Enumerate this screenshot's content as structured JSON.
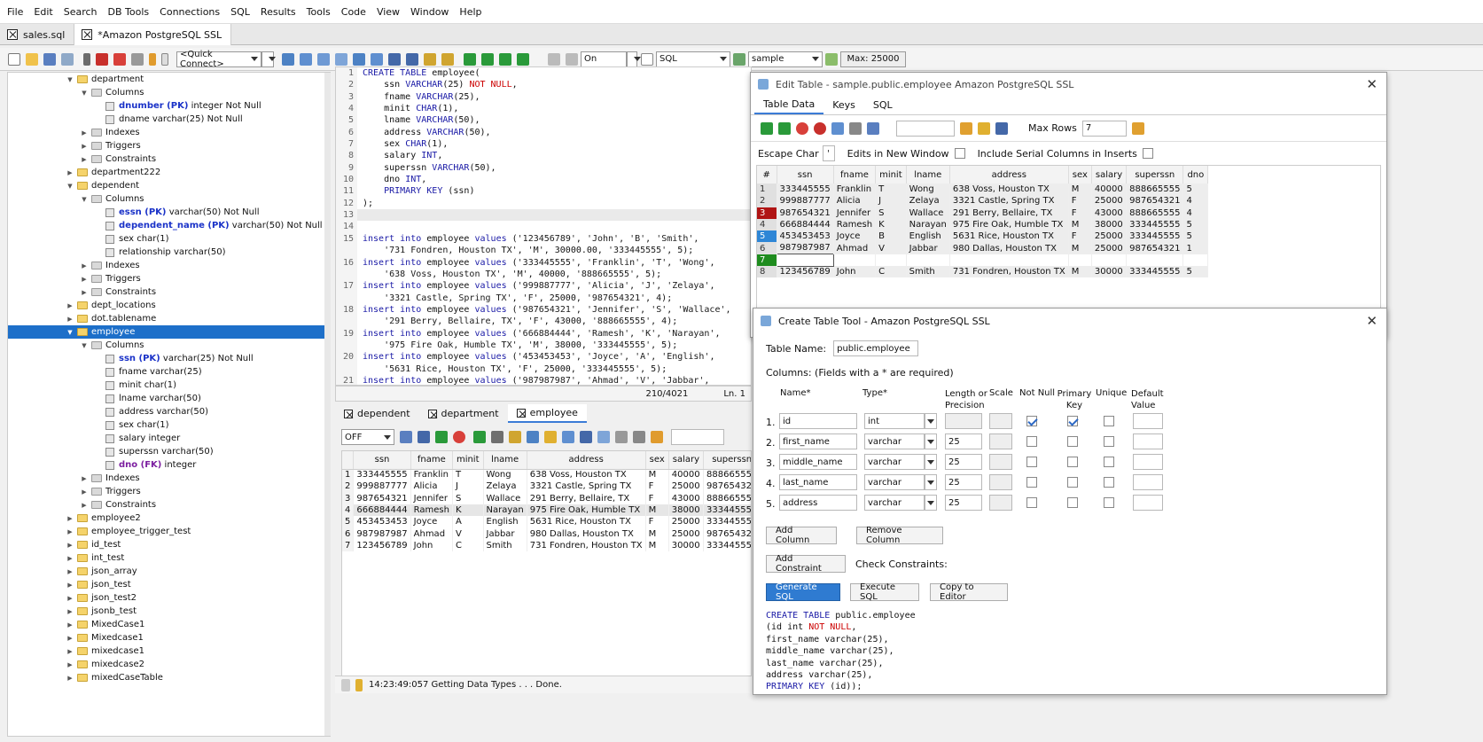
{
  "menu": [
    "File",
    "Edit",
    "Search",
    "DB Tools",
    "Connections",
    "SQL",
    "Results",
    "Tools",
    "Code",
    "View",
    "Window",
    "Help"
  ],
  "file_tabs": [
    "sales.sql",
    "*Amazon PostgreSQL SSL"
  ],
  "toolbar": {
    "quick_connect": "<Quick Connect>",
    "autocommit": "On",
    "mode": "SQL",
    "database": "sample",
    "max_label": "Max: 25000"
  },
  "tree": [
    {
      "label": "department",
      "type": "table",
      "indent": 0,
      "expanded": true
    },
    {
      "label": "Columns",
      "type": "folder",
      "indent": 1,
      "expanded": true
    },
    {
      "name": "dnumber (PK)",
      "rest": " integer Not Null",
      "cls": "pk",
      "type": "col",
      "indent": 2
    },
    {
      "name": "",
      "rest": "dname varchar(25) Not Null",
      "type": "col",
      "indent": 2
    },
    {
      "label": "Indexes",
      "type": "folder",
      "indent": 1
    },
    {
      "label": "Triggers",
      "type": "folder",
      "indent": 1
    },
    {
      "label": "Constraints",
      "type": "folder",
      "indent": 1
    },
    {
      "label": "department222",
      "type": "table",
      "indent": 0
    },
    {
      "label": "dependent",
      "type": "table",
      "indent": 0,
      "expanded": true
    },
    {
      "label": "Columns",
      "type": "folder",
      "indent": 1,
      "expanded": true
    },
    {
      "name": "essn (PK)",
      "rest": " varchar(50) Not Null",
      "cls": "pk",
      "type": "col",
      "indent": 2
    },
    {
      "name": "dependent_name (PK)",
      "rest": " varchar(50) Not Null",
      "cls": "pk",
      "type": "col",
      "indent": 2
    },
    {
      "name": "",
      "rest": "sex char(1)",
      "type": "col",
      "indent": 2
    },
    {
      "name": "",
      "rest": "relationship varchar(50)",
      "type": "col",
      "indent": 2
    },
    {
      "label": "Indexes",
      "type": "folder",
      "indent": 1
    },
    {
      "label": "Triggers",
      "type": "folder",
      "indent": 1
    },
    {
      "label": "Constraints",
      "type": "folder",
      "indent": 1
    },
    {
      "label": "dept_locations",
      "type": "table",
      "indent": 0
    },
    {
      "label": "dot.tablename",
      "type": "table",
      "indent": 0
    },
    {
      "label": "employee",
      "type": "table",
      "indent": 0,
      "expanded": true,
      "selected": true
    },
    {
      "label": "Columns",
      "type": "folder",
      "indent": 1,
      "expanded": true
    },
    {
      "name": "ssn (PK)",
      "rest": " varchar(25) Not Null",
      "cls": "pk",
      "type": "col",
      "indent": 2
    },
    {
      "name": "",
      "rest": "fname varchar(25)",
      "type": "col",
      "indent": 2
    },
    {
      "name": "",
      "rest": "minit char(1)",
      "type": "col",
      "indent": 2
    },
    {
      "name": "",
      "rest": "lname varchar(50)",
      "type": "col",
      "indent": 2
    },
    {
      "name": "",
      "rest": "address varchar(50)",
      "type": "col",
      "indent": 2
    },
    {
      "name": "",
      "rest": "sex char(1)",
      "type": "col",
      "indent": 2
    },
    {
      "name": "",
      "rest": "salary integer",
      "type": "col",
      "indent": 2
    },
    {
      "name": "",
      "rest": "superssn varchar(50)",
      "type": "col",
      "indent": 2
    },
    {
      "name": "dno (FK)",
      "rest": " integer",
      "cls": "fk",
      "type": "col",
      "indent": 2
    },
    {
      "label": "Indexes",
      "type": "folder",
      "indent": 1
    },
    {
      "label": "Triggers",
      "type": "folder",
      "indent": 1
    },
    {
      "label": "Constraints",
      "type": "folder",
      "indent": 1
    },
    {
      "label": "employee2",
      "type": "table",
      "indent": 0
    },
    {
      "label": "employee_trigger_test",
      "type": "table",
      "indent": 0
    },
    {
      "label": "id_test",
      "type": "table",
      "indent": 0
    },
    {
      "label": "int_test",
      "type": "table",
      "indent": 0
    },
    {
      "label": "json_array",
      "type": "table",
      "indent": 0
    },
    {
      "label": "json_test",
      "type": "table",
      "indent": 0
    },
    {
      "label": "json_test2",
      "type": "table",
      "indent": 0
    },
    {
      "label": "jsonb_test",
      "type": "table",
      "indent": 0
    },
    {
      "label": "MixedCase1",
      "type": "table",
      "indent": 0
    },
    {
      "label": "Mixedcase1",
      "type": "table",
      "indent": 0
    },
    {
      "label": "mixedcase1",
      "type": "table",
      "indent": 0
    },
    {
      "label": "mixedcase2",
      "type": "table",
      "indent": 0
    },
    {
      "label": "mixedCaseTable",
      "type": "table",
      "indent": 0
    }
  ],
  "editor": {
    "lines": [
      "CREATE TABLE employee(",
      "    ssn VARCHAR(25) NOT NULL,",
      "    fname VARCHAR(25),",
      "    minit CHAR(1),",
      "    lname VARCHAR(50),",
      "    address VARCHAR(50),",
      "    sex CHAR(1),",
      "    salary INT,",
      "    superssn VARCHAR(50),",
      "    dno INT,",
      "    PRIMARY KEY (ssn)",
      ");",
      "",
      "",
      "insert into employee values ('123456789', 'John', 'B', 'Smith',",
      "    '731 Fondren, Houston TX', 'M', 30000.00, '333445555', 5);",
      "insert into employee values ('333445555', 'Franklin', 'T', 'Wong',",
      "    '638 Voss, Houston TX', 'M', 40000, '888665555', 5);",
      "insert into employee values ('999887777', 'Alicia', 'J', 'Zelaya',",
      "    '3321 Castle, Spring TX', 'F', 25000, '987654321', 4);",
      "insert into employee values ('987654321', 'Jennifer', 'S', 'Wallace',",
      "    '291 Berry, Bellaire, TX', 'F', 43000, '888665555', 4);",
      "insert into employee values ('666884444', 'Ramesh', 'K', 'Narayan',",
      "    '975 Fire Oak, Humble TX', 'M', 38000, '333445555', 5);",
      "insert into employee values ('453453453', 'Joyce', 'A', 'English',",
      "    '5631 Rice, Houston TX', 'F', 25000, '333445555', 5);",
      "insert into employee values ('987987987', 'Ahmad', 'V', 'Jabbar',"
    ],
    "line_numbers": [
      "1",
      "2",
      "3",
      "4",
      "5",
      "6",
      "7",
      "8",
      "9",
      "10",
      "11",
      "12",
      "13",
      "14",
      "15",
      "",
      "16",
      "",
      "17",
      "",
      "18",
      "",
      "19",
      "",
      "20",
      "",
      "21"
    ],
    "current_line": 13,
    "position": "210/4021",
    "ln_label": "Ln. 1"
  },
  "result_tabs": [
    "dependent",
    "department",
    "employee"
  ],
  "result_toolbar": {
    "select": "OFF"
  },
  "result_grid": {
    "columns": [
      "",
      "ssn",
      "fname",
      "minit",
      "lname",
      "address",
      "sex",
      "salary",
      "superssn",
      "d"
    ],
    "rows": [
      [
        "1",
        "333445555",
        "Franklin",
        "T",
        "Wong",
        "638 Voss, Houston TX",
        "M",
        "40000",
        "888665555",
        "5"
      ],
      [
        "2",
        "999887777",
        "Alicia",
        "J",
        "Zelaya",
        "3321 Castle, Spring TX",
        "F",
        "25000",
        "987654321",
        "4"
      ],
      [
        "3",
        "987654321",
        "Jennifer",
        "S",
        "Wallace",
        "291 Berry, Bellaire, TX",
        "F",
        "43000",
        "888665555",
        "4"
      ],
      [
        "4",
        "666884444",
        "Ramesh",
        "K",
        "Narayan",
        "975 Fire Oak, Humble TX",
        "M",
        "38000",
        "333445555",
        "5"
      ],
      [
        "5",
        "453453453",
        "Joyce",
        "A",
        "English",
        "5631 Rice, Houston TX",
        "F",
        "25000",
        "333445555",
        "5"
      ],
      [
        "6",
        "987987987",
        "Ahmad",
        "V",
        "Jabbar",
        "980 Dallas, Houston TX",
        "M",
        "25000",
        "987654321",
        "1"
      ],
      [
        "7",
        "123456789",
        "John",
        "C",
        "Smith",
        "731 Fondren, Houston TX",
        "M",
        "30000",
        "333445555",
        "5"
      ]
    ]
  },
  "status": "14:23:49:057 Getting Data Types . . . Done.",
  "edit_table": {
    "title": "Edit Table - sample.public.employee Amazon PostgreSQL SSL",
    "tabs": [
      "Table Data",
      "Keys",
      "SQL"
    ],
    "max_rows_label": "Max Rows",
    "max_rows": "7",
    "escape_label": "Escape Char",
    "escape_value": "'",
    "edits_new_window": "Edits in New Window",
    "include_serial": "Include Serial Columns in Inserts",
    "columns": [
      "#",
      "ssn",
      "fname",
      "minit",
      "lname",
      "address",
      "sex",
      "salary",
      "superssn",
      "dno"
    ],
    "rows": [
      [
        "1",
        "333445555",
        "Franklin",
        "T",
        "Wong",
        "638 Voss, Houston TX",
        "M",
        "40000",
        "888665555",
        "5"
      ],
      [
        "2",
        "999887777",
        "Alicia",
        "J",
        "Zelaya",
        "3321 Castle, Spring TX",
        "F",
        "25000",
        "987654321",
        "4"
      ],
      [
        "3",
        "987654321",
        "Jennifer",
        "S",
        "Wallace",
        "291 Berry, Bellaire, TX",
        "F",
        "43000",
        "888665555",
        "4"
      ],
      [
        "4",
        "666884444",
        "Ramesh",
        "K",
        "Narayan",
        "975 Fire Oak, Humble TX",
        "M",
        "38000",
        "333445555",
        "5"
      ],
      [
        "5",
        "453453453",
        "Joyce",
        "B",
        "English",
        "5631 Rice, Houston TX",
        "F",
        "25000",
        "333445555",
        "5"
      ],
      [
        "6",
        "987987987",
        "Ahmad",
        "V",
        "Jabbar",
        "980 Dallas, Houston TX",
        "M",
        "25000",
        "987654321",
        "1"
      ],
      [
        "7",
        "",
        "",
        "",
        "",
        "",
        "",
        "",
        "",
        ""
      ],
      [
        "8",
        "123456789",
        "John",
        "C",
        "Smith",
        "731 Fondren, Houston TX",
        "M",
        "30000",
        "333445555",
        "5"
      ]
    ],
    "row_marker_colors": {
      "3": "#b01414",
      "5": "#2e86d6",
      "7": "#1e8c1e"
    }
  },
  "create_table": {
    "title": "Create Table Tool - Amazon PostgreSQL SSL",
    "table_name_label": "Table Name:",
    "table_name": "public.employee",
    "columns_label": "Columns: (Fields with a * are required)",
    "headers": {
      "name": "Name*",
      "type": "Type*",
      "length": "Length or Precision",
      "scale": "Scale",
      "not_null": "Not Null",
      "pk": "Primary Key",
      "unique": "Unique",
      "default": "Default Value"
    },
    "rows": [
      {
        "n": "1.",
        "name": "id",
        "type": "int",
        "length": "",
        "notnull": true,
        "pk": true
      },
      {
        "n": "2.",
        "name": "first_name",
        "type": "varchar",
        "length": "25",
        "notnull": false,
        "pk": false
      },
      {
        "n": "3.",
        "name": "middle_name",
        "type": "varchar",
        "length": "25",
        "notnull": false,
        "pk": false
      },
      {
        "n": "4.",
        "name": "last_name",
        "type": "varchar",
        "length": "25",
        "notnull": false,
        "pk": false
      },
      {
        "n": "5.",
        "name": "address",
        "type": "varchar",
        "length": "25",
        "notnull": false,
        "pk": false
      }
    ],
    "add_column": "Add Column",
    "remove_column": "Remove Column",
    "add_constraint": "Add Constraint",
    "check_constraints": "Check Constraints:",
    "generate_sql": "Generate SQL",
    "execute_sql": "Execute SQL",
    "copy_to_editor": "Copy to Editor",
    "sql_lines": [
      "CREATE TABLE public.employee",
      "(id int NOT NULL,",
      "first_name varchar(25),",
      "middle_name varchar(25),",
      "last_name varchar(25),",
      "address varchar(25),",
      "PRIMARY KEY (id));"
    ]
  }
}
